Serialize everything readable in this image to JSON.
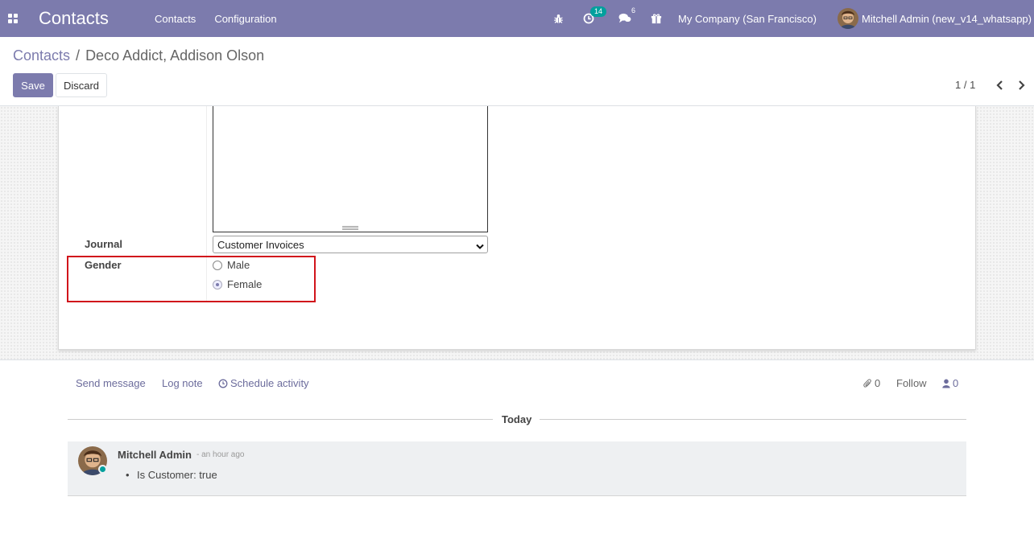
{
  "navbar": {
    "app_title": "Contacts",
    "menu": [
      "Contacts",
      "Configuration"
    ],
    "activity_count": "14",
    "messages_count": "6",
    "company": "My Company (San Francisco)",
    "user": "Mitchell Admin (new_v14_whatsapp)"
  },
  "breadcrumb": {
    "parent": "Contacts",
    "separator": "/",
    "current": "Deco Addict, Addison Olson"
  },
  "buttons": {
    "save": "Save",
    "discard": "Discard"
  },
  "pager": {
    "value": "1 / 1"
  },
  "form": {
    "journal_label": "Journal",
    "journal_value": "Customer Invoices",
    "gender_label": "Gender",
    "gender_options": [
      {
        "label": "Male",
        "checked": false
      },
      {
        "label": "Female",
        "checked": true
      }
    ]
  },
  "chatter": {
    "send_message": "Send message",
    "log_note": "Log note",
    "schedule_activity": "Schedule activity",
    "attachments_count": "0",
    "follow": "Follow",
    "followers_count": "0",
    "today": "Today",
    "message": {
      "author": "Mitchell Admin",
      "date": "- an hour ago",
      "body": "Is Customer: true"
    }
  },
  "colors": {
    "brand": "#7c7bad",
    "highlight": "#d1141b",
    "online": "#00a09d"
  }
}
